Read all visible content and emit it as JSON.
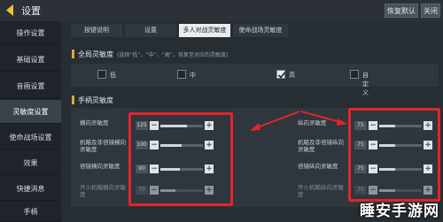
{
  "header": {
    "title": "设置",
    "buttons": [
      "恢复默认",
      "关闭"
    ]
  },
  "sidebar": {
    "items": [
      {
        "label": "操作设置",
        "active": false
      },
      {
        "label": "基础设置",
        "active": false
      },
      {
        "label": "音画设置",
        "active": false
      },
      {
        "label": "灵敏度设置",
        "active": true
      },
      {
        "label": "使命战场设置",
        "active": false
      },
      {
        "label": "效果",
        "active": false
      },
      {
        "label": "快捷消息",
        "active": false
      },
      {
        "label": "手柄",
        "active": false
      }
    ]
  },
  "tabs": [
    {
      "label": "按键说明",
      "active": false
    },
    {
      "label": "设置",
      "active": false
    },
    {
      "label": "多人对战灵敏度",
      "active": true
    },
    {
      "label": "使命战场灵敏度",
      "active": false
    }
  ],
  "global_sensitivity": {
    "title": "全局灵敏度",
    "hint": "(选择“低”、“中”、“高”，恢复至对应的灵敏度)",
    "options": [
      {
        "label": "低",
        "checked": false
      },
      {
        "label": "中",
        "checked": false
      },
      {
        "label": "高",
        "checked": true
      },
      {
        "label": "自定义",
        "checked": false
      }
    ]
  },
  "controller_sensitivity": {
    "title": "手柄灵敏度",
    "left_rows": [
      {
        "label": "横向灵敏度",
        "value": "125",
        "level": 0.62
      },
      {
        "label": "机瞄及非倍镜横向灵敏度",
        "value": "100",
        "level": 0.5
      },
      {
        "label": "倍镜横向灵敏度",
        "value": "90",
        "level": 0.45
      },
      {
        "label": "开火机瞄横向灵敏度",
        "value": "70",
        "level": 0.35
      }
    ],
    "right_rows": [
      {
        "label": "纵向灵敏度",
        "value": "75",
        "level": 0.38
      },
      {
        "label": "机瞄及非倍镜纵向灵敏度",
        "value": "75",
        "level": 0.38
      },
      {
        "label": "倍镜纵向灵敏度",
        "value": "75",
        "level": 0.38
      },
      {
        "label": "开火机瞄纵向灵敏度",
        "value": "75",
        "level": 0.38
      }
    ],
    "minus": "−",
    "plus": "+"
  },
  "watermark": "睡安手游网",
  "colors": {
    "highlight": "#e5242a",
    "accent": "#e0a53b"
  }
}
